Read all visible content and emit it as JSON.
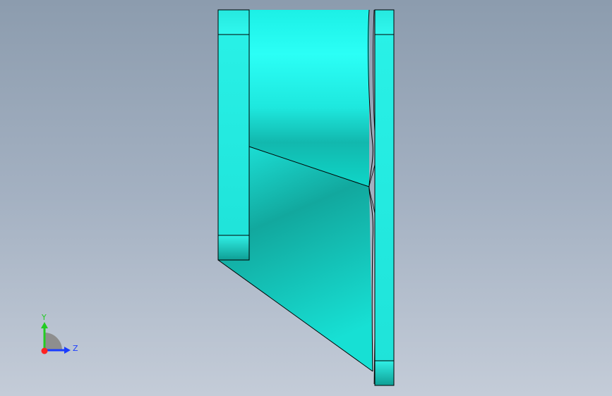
{
  "viewport": {
    "background_top": "#8c9cae",
    "background_bottom": "#c4ccd8"
  },
  "model": {
    "name": "part-side-view",
    "fill_color": "#00ffee",
    "edge_color": "#000000"
  },
  "triad": {
    "y_label": "Y",
    "z_label": "Z",
    "y_color": "#22cc22",
    "z_color": "#1a3cff",
    "x_color": "#ff2222"
  }
}
